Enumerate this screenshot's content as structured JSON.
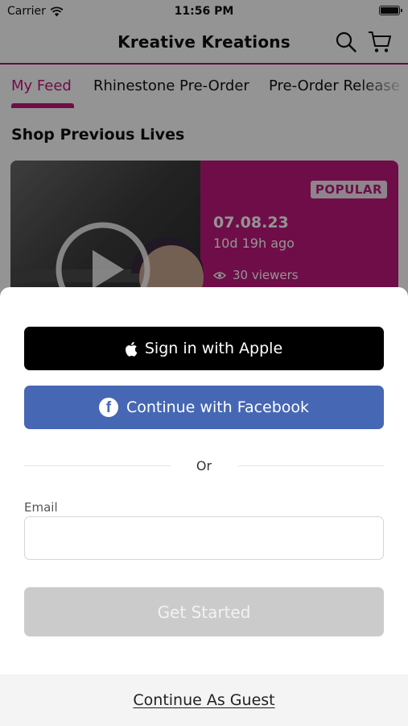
{
  "status_bar": {
    "carrier": "Carrier",
    "time": "11:56 PM"
  },
  "header": {
    "title": "Kreative Kreations"
  },
  "tabs": [
    {
      "label": "My Feed",
      "active": true
    },
    {
      "label": "Rhinestone Pre-Order",
      "active": false
    },
    {
      "label": "Pre-Order Release",
      "active": false
    }
  ],
  "section": {
    "title": "Shop Previous Lives"
  },
  "live_card": {
    "badge": "POPULAR",
    "date": "07.08.23",
    "ago": "10d 19h ago",
    "viewers": "30 viewers"
  },
  "sheet": {
    "apple_label": "Sign in with Apple",
    "facebook_label": "Continue with Facebook",
    "or_label": "Or",
    "email_label": "Email",
    "email_value": "",
    "email_placeholder": "",
    "get_started_label": "Get Started",
    "guest_label": "Continue As Guest"
  },
  "colors": {
    "brand": "#c0187e",
    "facebook": "#4667b4",
    "apple": "#000000",
    "disabled": "#cbcbcb"
  }
}
